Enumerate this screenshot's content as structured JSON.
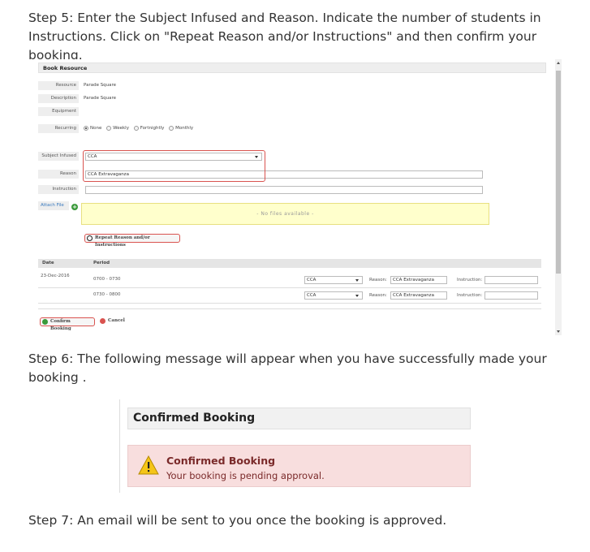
{
  "step5": "Step 5: Enter the Subject Infused and Reason. Indicate the number of students in Instructions. Click on \"Repeat Reason and/or Instructions\" and then confirm your booking.",
  "step6": "Step 6: The following message will appear when you have successfully made your booking .",
  "step7": "Step 7: An email will be sent to you once the booking is approved.",
  "form": {
    "title": "Book Resource",
    "resource_label": "Resource",
    "resource_value": "Parade Square",
    "description_label": "Description",
    "description_value": "Parade Square",
    "equipment_label": "Equipment",
    "recurring_label": "Recurring",
    "recurring_options": [
      "None",
      "Weekly",
      "Fortnightly",
      "Monthly"
    ],
    "recurring_selected": "None",
    "subject_label": "Subject Infused",
    "subject_value": "CCA",
    "reason_label": "Reason",
    "reason_value": "CCA Extravaganza",
    "instruction_label": "Instruction",
    "instruction_value": "",
    "attach_label": "Attach File",
    "no_files": "- No files available -",
    "repeat_button": "Repeat Reason and/or Instructions",
    "date_header": "Date",
    "period_header": "Period",
    "rows": [
      {
        "date": "23-Dec-2016",
        "period": "0700 - 0730",
        "subject": "CCA",
        "reason_label": "Reason:",
        "reason": "CCA Extravaganza",
        "instruction_label": "Instruction:",
        "instruction": ""
      },
      {
        "date": "",
        "period": "0730 - 0800",
        "subject": "CCA",
        "reason_label": "Reason:",
        "reason": "CCA Extravaganza",
        "instruction_label": "Instruction:",
        "instruction": ""
      }
    ],
    "confirm_button": "Confirm Booking",
    "cancel_button": "Cancel"
  },
  "confirmed": {
    "title": "Confirmed Booking",
    "alert_title": "Confirmed Booking",
    "alert_text": "Your booking is pending approval."
  },
  "colors": {
    "highlight": "#d9534f",
    "alert_bg": "#f8dede",
    "alert_text": "#7a2a2a",
    "file_box": "#ffffcc"
  },
  "icons": [
    "plus-icon",
    "refresh-icon",
    "check-icon",
    "cancel-icon",
    "warning-icon",
    "chevron-down-icon"
  ]
}
